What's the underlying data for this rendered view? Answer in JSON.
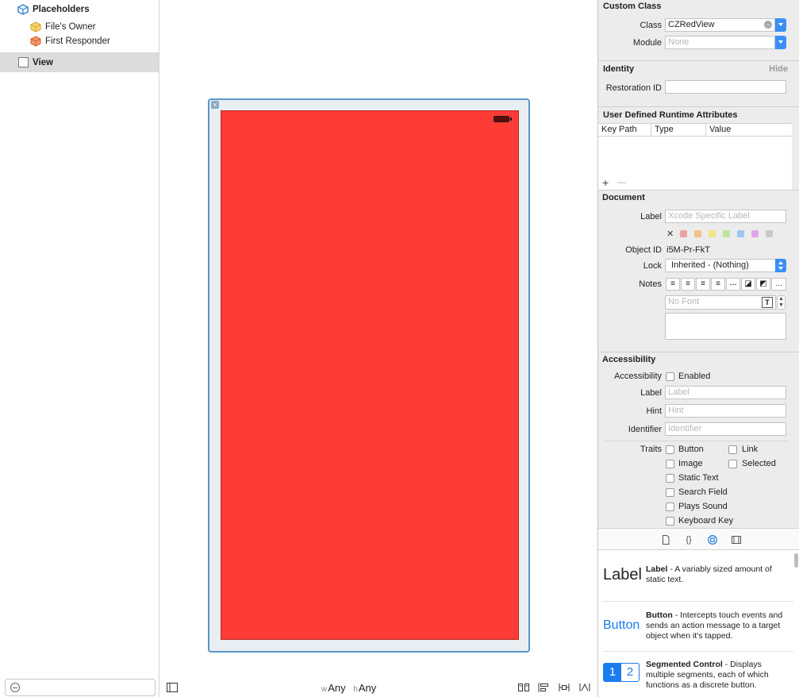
{
  "outline": {
    "placeholders": "Placeholders",
    "files_owner": "File's Owner",
    "first_responder": "First Responder",
    "view": "View"
  },
  "canvas": {
    "size_w_prefix": "w",
    "size_w": "Any",
    "size_h_prefix": "h",
    "size_h": "Any"
  },
  "inspector": {
    "custom_class": {
      "title": "Custom Class",
      "class_label": "Class",
      "class_value": "CZRedView",
      "module_label": "Module",
      "module_placeholder": "None"
    },
    "identity": {
      "title": "Identity",
      "hide": "Hide",
      "restoration_label": "Restoration ID"
    },
    "runtime": {
      "title": "User Defined Runtime Attributes",
      "columns": [
        "Key Path",
        "Type",
        "Value"
      ],
      "add": "+",
      "remove": "—"
    },
    "document": {
      "title": "Document",
      "label_label": "Label",
      "label_placeholder": "Xcode Specific Label",
      "clear_color": "✕",
      "colors": [
        "#f0a0a0",
        "#f5c08a",
        "#f2e68a",
        "#bfe49a",
        "#9fc6f2",
        "#e0a8e8",
        "#c8c8c8"
      ],
      "object_id_label": "Object ID",
      "object_id": "i5M-Pr-FkT",
      "lock_label": "Lock",
      "lock_value": "Inherited - (Nothing)",
      "notes_label": "Notes",
      "font_placeholder": "No Font",
      "more": "..."
    },
    "accessibility": {
      "title": "Accessibility",
      "acc_label": "Accessibility",
      "enabled": "Enabled",
      "label_label": "Label",
      "label_placeholder": "Label",
      "hint_label": "Hint",
      "hint_placeholder": "Hint",
      "identifier_label": "Identifier",
      "identifier_placeholder": "Identifier",
      "traits_label": "Traits",
      "traits": {
        "button": "Button",
        "link": "Link",
        "image": "Image",
        "selected": "Selected",
        "static_text": "Static Text",
        "search_field": "Search Field",
        "plays_sound": "Plays Sound",
        "keyboard_key": "Keyboard Key"
      }
    }
  },
  "library": {
    "label_item": {
      "thumb": "Label",
      "name": "Label",
      "desc": " - A variably sized amount of static text."
    },
    "button_item": {
      "thumb": "Button",
      "name": "Button",
      "desc": " - Intercepts touch events and sends an action message to a target object when it's tapped."
    },
    "segmented_item": {
      "seg1": "1",
      "seg2": "2",
      "name": "Segmented Control",
      "desc": " - Displays multiple segments, each of which functions as a discrete button."
    }
  },
  "colors": {
    "accent": "#3a8ff5",
    "view_red": "#ff3b35",
    "frame_blue": "#5b97c9"
  }
}
